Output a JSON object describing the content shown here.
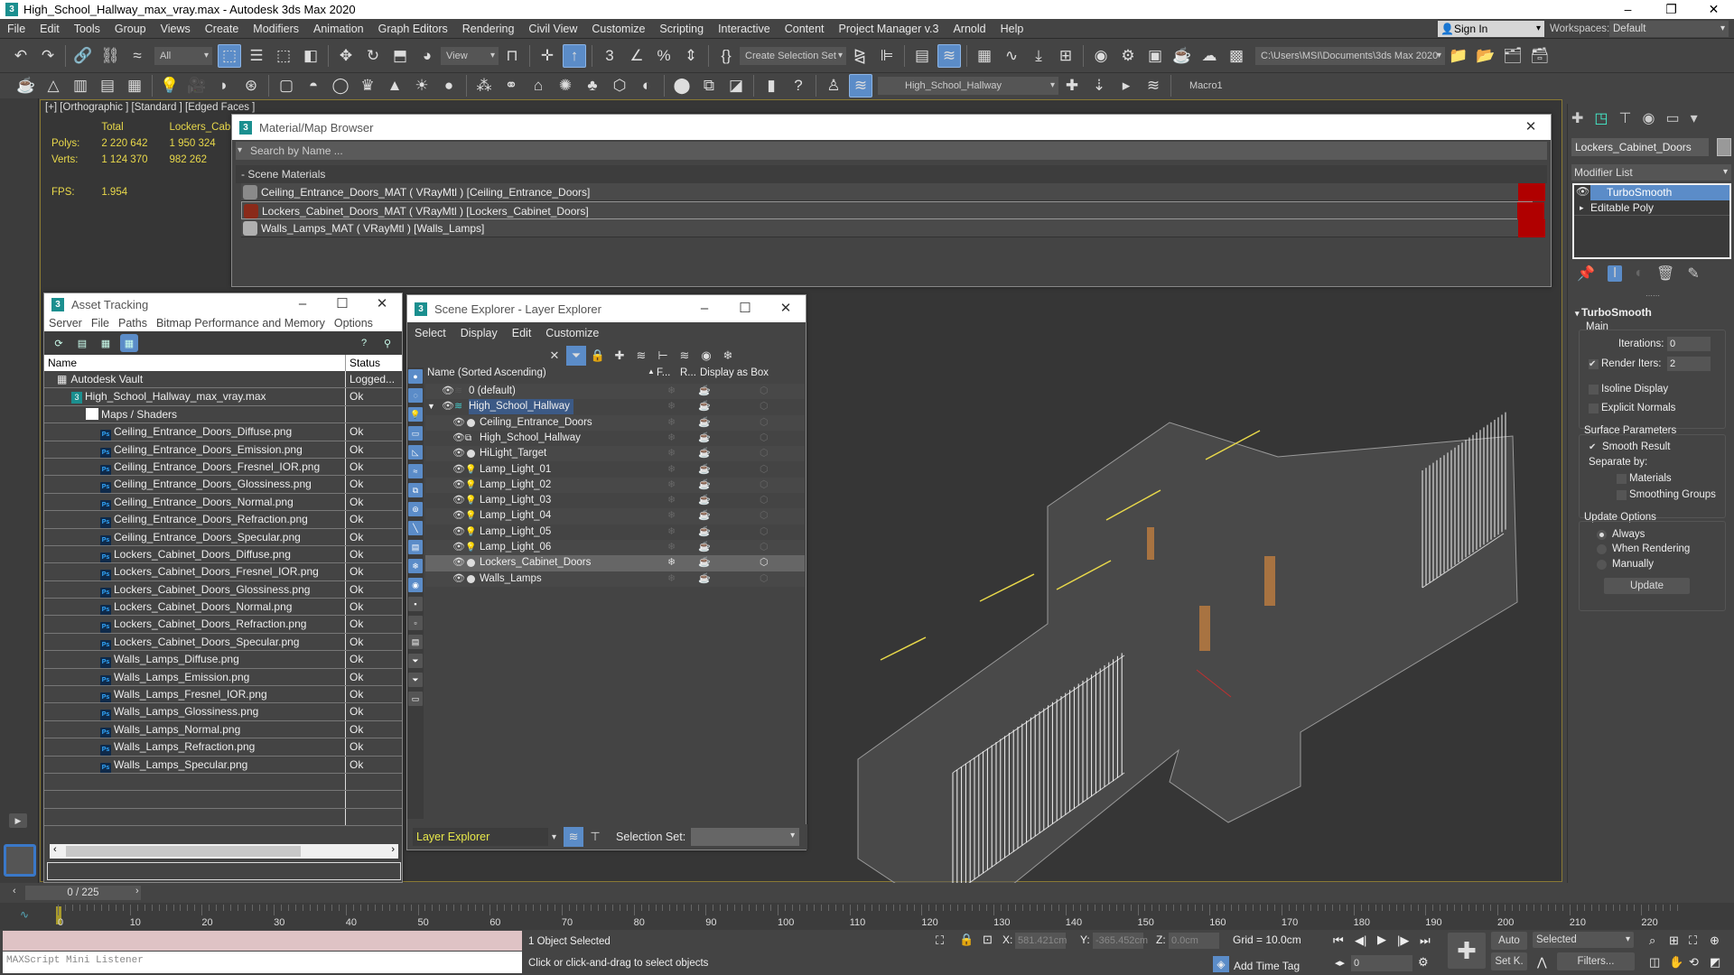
{
  "window": {
    "title": "High_School_Hallway_max_vray.max - Autodesk 3ds Max 2020",
    "app_icon": "3ds-max-icon"
  },
  "menu": [
    "File",
    "Edit",
    "Tools",
    "Group",
    "Views",
    "Create",
    "Modifiers",
    "Animation",
    "Graph Editors",
    "Rendering",
    "Civil View",
    "Customize",
    "Scripting",
    "Interactive",
    "Content",
    "Project Manager v.3",
    "Arnold",
    "Help"
  ],
  "account": {
    "sign_in": "Sign In",
    "workspaces_label": "Workspaces:",
    "workspace": "Default"
  },
  "toolbar": {
    "selection_filter": "All",
    "ref_coord": "View",
    "selection_set": "Create Selection Set",
    "project_path": "C:\\Users\\MSI\\Documents\\3ds Max 2020",
    "layer": "High_School_Hallway",
    "macro": "Macro1"
  },
  "viewport": {
    "label": "[+] [Orthographic ] [Standard ] [Edged Faces ]",
    "stats": {
      "col_total": "Total",
      "col_selected": "Lockers_Cabinet_",
      "polys_label": "Polys:",
      "polys_total": "2 220 642",
      "polys_selected": "1 950 324",
      "verts_label": "Verts:",
      "verts_total": "1 124 370",
      "verts_selected": "982 262",
      "fps_label": "FPS:",
      "fps": "1.954"
    }
  },
  "material_browser": {
    "title": "Material/Map Browser",
    "search_placeholder": "Search by Name ...",
    "section": "- Scene Materials",
    "materials": [
      {
        "label": "Ceiling_Entrance_Doors_MAT  ( VRayMtl )  [Ceiling_Entrance_Doors]",
        "color": "#8a8a8a"
      },
      {
        "label": "Lockers_Cabinet_Doors_MAT  ( VRayMtl )  [Lockers_Cabinet_Doors]",
        "color": "#8a2a1a"
      },
      {
        "label": "Walls_Lamps_MAT  ( VRayMtl )  [Walls_Lamps]",
        "color": "#b0b0b0"
      }
    ]
  },
  "asset_tracking": {
    "title": "Asset Tracking",
    "menu": [
      "Server",
      "File",
      "Paths",
      "Bitmap Performance and Memory",
      "Options"
    ],
    "columns": [
      "Name",
      "Status"
    ],
    "rows": [
      {
        "name": "Autodesk Vault",
        "status": "Logged...",
        "level": 0,
        "icon": "vault-icon"
      },
      {
        "name": "High_School_Hallway_max_vray.max",
        "status": "Ok",
        "level": 1,
        "icon": "max-file-icon"
      },
      {
        "name": "Maps / Shaders",
        "status": "",
        "level": 2,
        "icon": "folder-icon"
      },
      {
        "name": "Ceiling_Entrance_Doors_Diffuse.png",
        "status": "Ok",
        "level": 3,
        "icon": "ps"
      },
      {
        "name": "Ceiling_Entrance_Doors_Emission.png",
        "status": "Ok",
        "level": 3,
        "icon": "ps"
      },
      {
        "name": "Ceiling_Entrance_Doors_Fresnel_IOR.png",
        "status": "Ok",
        "level": 3,
        "icon": "ps"
      },
      {
        "name": "Ceiling_Entrance_Doors_Glossiness.png",
        "status": "Ok",
        "level": 3,
        "icon": "ps"
      },
      {
        "name": "Ceiling_Entrance_Doors_Normal.png",
        "status": "Ok",
        "level": 3,
        "icon": "ps"
      },
      {
        "name": "Ceiling_Entrance_Doors_Refraction.png",
        "status": "Ok",
        "level": 3,
        "icon": "ps"
      },
      {
        "name": "Ceiling_Entrance_Doors_Specular.png",
        "status": "Ok",
        "level": 3,
        "icon": "ps"
      },
      {
        "name": "Lockers_Cabinet_Doors_Diffuse.png",
        "status": "Ok",
        "level": 3,
        "icon": "ps"
      },
      {
        "name": "Lockers_Cabinet_Doors_Fresnel_IOR.png",
        "status": "Ok",
        "level": 3,
        "icon": "ps"
      },
      {
        "name": "Lockers_Cabinet_Doors_Glossiness.png",
        "status": "Ok",
        "level": 3,
        "icon": "ps"
      },
      {
        "name": "Lockers_Cabinet_Doors_Normal.png",
        "status": "Ok",
        "level": 3,
        "icon": "ps"
      },
      {
        "name": "Lockers_Cabinet_Doors_Refraction.png",
        "status": "Ok",
        "level": 3,
        "icon": "ps"
      },
      {
        "name": "Lockers_Cabinet_Doors_Specular.png",
        "status": "Ok",
        "level": 3,
        "icon": "ps"
      },
      {
        "name": "Walls_Lamps_Diffuse.png",
        "status": "Ok",
        "level": 3,
        "icon": "ps"
      },
      {
        "name": "Walls_Lamps_Emission.png",
        "status": "Ok",
        "level": 3,
        "icon": "ps"
      },
      {
        "name": "Walls_Lamps_Fresnel_IOR.png",
        "status": "Ok",
        "level": 3,
        "icon": "ps"
      },
      {
        "name": "Walls_Lamps_Glossiness.png",
        "status": "Ok",
        "level": 3,
        "icon": "ps"
      },
      {
        "name": "Walls_Lamps_Normal.png",
        "status": "Ok",
        "level": 3,
        "icon": "ps"
      },
      {
        "name": "Walls_Lamps_Refraction.png",
        "status": "Ok",
        "level": 3,
        "icon": "ps"
      },
      {
        "name": "Walls_Lamps_Specular.png",
        "status": "Ok",
        "level": 3,
        "icon": "ps"
      }
    ]
  },
  "scene_explorer": {
    "title": "Scene Explorer - Layer Explorer",
    "menu": [
      "Select",
      "Display",
      "Edit",
      "Customize"
    ],
    "columns": {
      "name": "Name (Sorted Ascending)",
      "frozen": "F...",
      "render": "R...",
      "box": "Display as Box"
    },
    "rows": [
      {
        "name": "0 (default)",
        "level": 0,
        "type": "layer-default"
      },
      {
        "name": "High_School_Hallway",
        "level": 0,
        "type": "layer-active",
        "expanded": true
      },
      {
        "name": "Ceiling_Entrance_Doors",
        "level": 1,
        "type": "object"
      },
      {
        "name": "High_School_Hallway",
        "level": 1,
        "type": "group"
      },
      {
        "name": "HiLight_Target",
        "level": 1,
        "type": "object"
      },
      {
        "name": "Lamp_Light_01",
        "level": 1,
        "type": "light"
      },
      {
        "name": "Lamp_Light_02",
        "level": 1,
        "type": "light"
      },
      {
        "name": "Lamp_Light_03",
        "level": 1,
        "type": "light"
      },
      {
        "name": "Lamp_Light_04",
        "level": 1,
        "type": "light"
      },
      {
        "name": "Lamp_Light_05",
        "level": 1,
        "type": "light"
      },
      {
        "name": "Lamp_Light_06",
        "level": 1,
        "type": "light"
      },
      {
        "name": "Lockers_Cabinet_Doors",
        "level": 1,
        "type": "object",
        "selected": true
      },
      {
        "name": "Walls_Lamps",
        "level": 1,
        "type": "object"
      }
    ],
    "footer": {
      "explorer": "Layer Explorer",
      "selection_set_label": "Selection Set:",
      "selection_set": ""
    }
  },
  "command_panel": {
    "object_name": "Lockers_Cabinet_Doors",
    "modifier_list": "Modifier List",
    "stack": [
      "TurboSmooth",
      "Editable Poly"
    ],
    "rollout_title": "TurboSmooth",
    "main_label": "Main",
    "iterations_label": "Iterations:",
    "iterations": "0",
    "render_iters_label": "Render Iters:",
    "render_iters": "2",
    "render_iters_checked": true,
    "isoline": "Isoline Display",
    "isoline_checked": false,
    "explicit_normals": "Explicit Normals",
    "explicit_normals_checked": false,
    "surface_params": "Surface Parameters",
    "smooth_result": "Smooth Result",
    "smooth_result_checked": true,
    "separate_by": "Separate by:",
    "materials": "Materials",
    "smoothing_groups": "Smoothing Groups",
    "update_options": "Update Options",
    "always": "Always",
    "when_rendering": "When Rendering",
    "manually": "Manually",
    "update_mode": "Always",
    "update_button": "Update"
  },
  "timeline": {
    "frame_display": "0 / 225",
    "current_frame": 0,
    "total_frames": 225,
    "ticks": [
      "0",
      "10",
      "20",
      "30",
      "40",
      "50",
      "60",
      "70",
      "80",
      "90",
      "100",
      "110",
      "120",
      "130",
      "140",
      "150",
      "160",
      "170",
      "180",
      "190",
      "200",
      "210",
      "220"
    ]
  },
  "status": {
    "listener_label": "MAXScript Mini Listener",
    "selected": "1 Object Selected",
    "prompt": "Click or click-and-drag to select objects",
    "x_label": "X:",
    "x": "581.421cm",
    "y_label": "Y:",
    "y": "-365.452cm",
    "z_label": "Z:",
    "z": "0.0cm",
    "grid": "Grid = 10.0cm",
    "add_time_tag": "Add Time Tag",
    "frame_field": "0",
    "auto_key": "Auto",
    "set_key": "Set K.",
    "key_filter_dropdown": "Selected",
    "filters": "Filters..."
  }
}
